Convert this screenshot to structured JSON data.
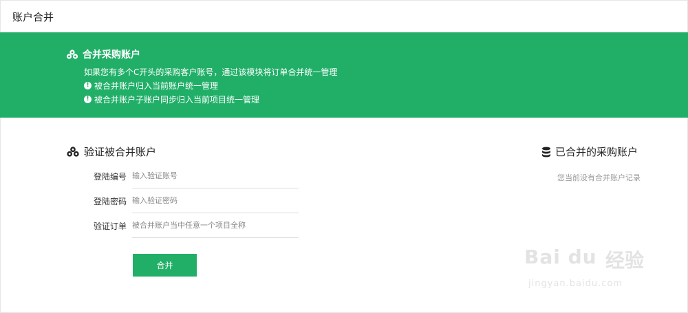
{
  "page": {
    "title": "账户合并"
  },
  "banner": {
    "title": "合并采购账户",
    "description": "如果您有多个C开头的采购客户账号，通过该模块将订单合并统一管理",
    "notes": [
      "被合并账户归入当前账户统一管理",
      "被合并账户子账户同步归入当前项目统一管理"
    ],
    "color": "#21af68"
  },
  "verify": {
    "title": "验证被合并账户",
    "fields": [
      {
        "label": "登陆编号",
        "placeholder": "输入验证账号"
      },
      {
        "label": "登陆密码",
        "placeholder": "输入验证密码"
      },
      {
        "label": "验证订单",
        "placeholder": "被合并账户当中任意一个项目全称"
      }
    ],
    "submit_label": "合并"
  },
  "merged": {
    "title": "已合并的采购账户",
    "empty_text": "您当前没有合并账户记录"
  },
  "watermark": {
    "logo": "Bai du",
    "cn": "经验",
    "url": "jingyan.baidu.com"
  },
  "icons": {
    "banner": "cubes-icon",
    "verify": "cubes-icon",
    "merged": "database-icon",
    "note": "info-icon"
  }
}
